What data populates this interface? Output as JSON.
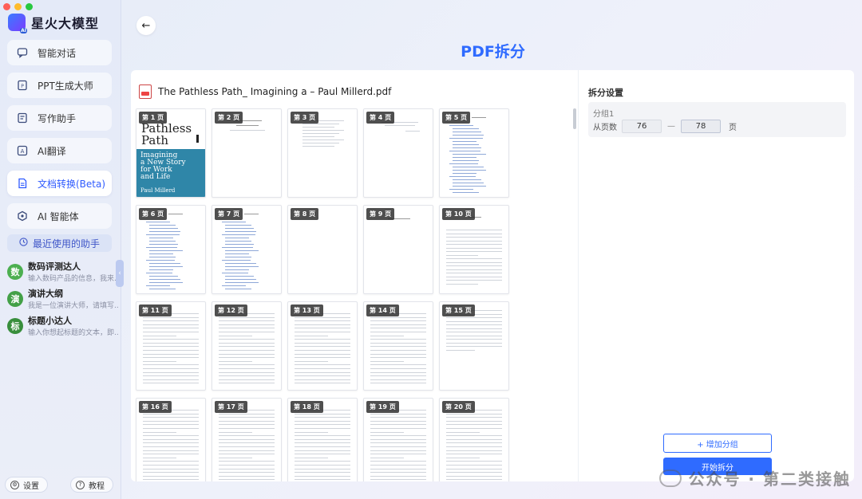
{
  "app": {
    "name": "星火大模型"
  },
  "colors": {
    "accent": "#2f6bff",
    "cover_blue": "#2f86a8"
  },
  "sidebar": {
    "items": [
      {
        "label": "智能对话",
        "icon": "chat-icon"
      },
      {
        "label": "PPT生成大师",
        "icon": "ppt-icon"
      },
      {
        "label": "写作助手",
        "icon": "pen-icon"
      },
      {
        "label": "AI翻译",
        "icon": "translate-icon"
      },
      {
        "label": "文档转换(Beta)",
        "icon": "document-icon",
        "active": true
      },
      {
        "label": "AI 智能体",
        "icon": "agent-icon"
      }
    ],
    "recent_title": "最近使用的助手",
    "assistants": [
      {
        "avatar": "数",
        "name": "数码评测达人",
        "desc": "输入数码产品的信息，我来...",
        "color": "#4caf50"
      },
      {
        "avatar": "演",
        "name": "演讲大纲",
        "desc": "我是一位演讲大师，请填写...",
        "color": "#43a047"
      },
      {
        "avatar": "标",
        "name": "标题小达人",
        "desc": "输入你想起标题的文本，即...",
        "color": "#388e3c"
      }
    ],
    "bottom": {
      "settings": "设置",
      "tutorial": "教程"
    }
  },
  "main": {
    "title": "PDF拆分",
    "file_name": "The Pathless Path_ Imagining a – Paul Millerd.pdf",
    "cover": {
      "title_line1": "Pathless",
      "title_line2": "Path",
      "subtitle_1": "Imagining",
      "subtitle_2": "a New Story",
      "subtitle_3": "for Work",
      "subtitle_4": "and Life",
      "author": "Paul Millerd"
    },
    "pages": [
      "第 1 页",
      "第 2 页",
      "第 3 页",
      "第 4 页",
      "第 5 页",
      "第 6 页",
      "第 7 页",
      "第 8 页",
      "第 9 页",
      "第 10 页",
      "第 11 页",
      "第 12 页",
      "第 13 页",
      "第 14 页",
      "第 15 页",
      "第 16 页",
      "第 17 页",
      "第 18 页",
      "第 19 页",
      "第 20 页"
    ]
  },
  "settings": {
    "title": "拆分设置",
    "group_name": "分组1",
    "from_label": "从页数",
    "from_value": "76",
    "to_value": "78",
    "page_unit": "页",
    "add_group": "+ 增加分组",
    "start": "开始拆分"
  },
  "watermark": "公众号 · 第二类接触"
}
